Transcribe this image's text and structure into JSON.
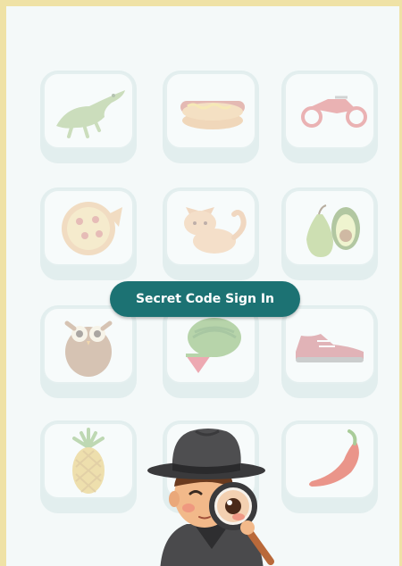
{
  "sign_in": {
    "button_label": "Secret Code Sign In"
  },
  "pictures": [
    {
      "name": "alligator",
      "icon": "alligator-icon",
      "color": "#7aa84a"
    },
    {
      "name": "hot dog",
      "icon": "hot-dog-icon",
      "color": "#d9874a"
    },
    {
      "name": "motorcycle",
      "icon": "motorcycle-icon",
      "color": "#d9474a"
    },
    {
      "name": "pizza",
      "icon": "pizza-icon",
      "color": "#e7a55a"
    },
    {
      "name": "cat",
      "icon": "cat-icon",
      "color": "#e8a46a"
    },
    {
      "name": "pear and avocado",
      "icon": "pear-avocado-icon",
      "color": "#9bbf5a"
    },
    {
      "name": "owl",
      "icon": "owl-icon",
      "color": "#a5714a"
    },
    {
      "name": "watermelon",
      "icon": "watermelon-icon",
      "color": "#6aa64a"
    },
    {
      "name": "sneaker",
      "icon": "sneaker-icon",
      "color": "#c24a52"
    },
    {
      "name": "pineapple",
      "icon": "pineapple-icon",
      "color": "#e3b63a"
    },
    {
      "name": "hidden",
      "icon": "hidden-icon",
      "color": "#cccccc"
    },
    {
      "name": "chili pepper",
      "icon": "chili-pepper-icon",
      "color": "#e0432e"
    }
  ],
  "colors": {
    "button": "#1c7273",
    "frame": "#efe2a6",
    "tile": "#e2eeee"
  },
  "mascot": {
    "icon": "detective-mascot-icon"
  }
}
